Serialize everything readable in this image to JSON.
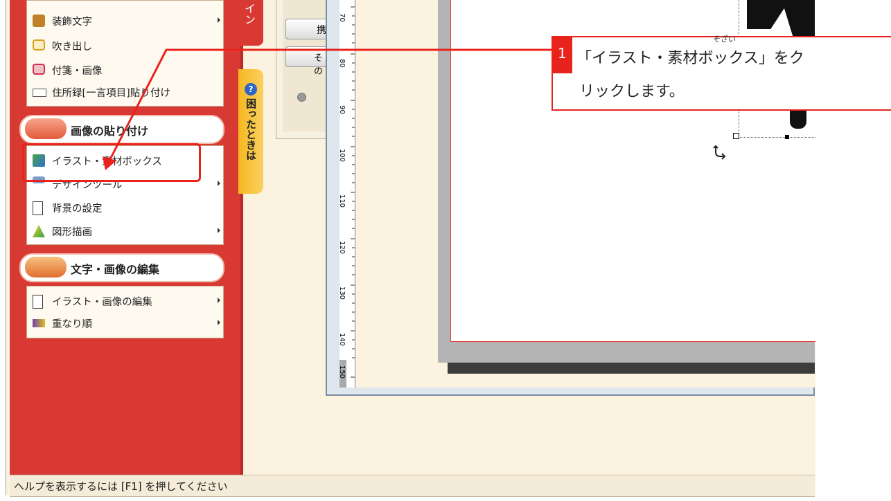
{
  "sidebar": {
    "tab_design": "イン",
    "help_tab": "困ったときは",
    "menu1": [
      {
        "label": "装飾文字",
        "icon": "decorative-text-icon",
        "has_submenu": true
      },
      {
        "label": "吹き出し",
        "icon": "speech-bubble-icon",
        "has_submenu": false
      },
      {
        "label": "付箋・画像",
        "icon": "sticky-note-icon",
        "has_submenu": false
      },
      {
        "label": "住所録[一言項目]貼り付け",
        "icon": "address-book-icon",
        "has_submenu": false
      }
    ],
    "section_paste": "画像の貼り付け",
    "menu2": [
      {
        "label": "イラスト・素材ボックス",
        "icon": "cube-icon",
        "has_submenu": false
      },
      {
        "label": "デザインツール",
        "icon": "design-tool-icon",
        "has_submenu": true
      },
      {
        "label": "背景の設定",
        "icon": "page-icon",
        "has_submenu": false
      },
      {
        "label": "図形描画",
        "icon": "shapes-icon",
        "has_submenu": true
      }
    ],
    "section_edit": "文字・画像の編集",
    "menu3": [
      {
        "label": "イラスト・画像の編集",
        "icon": "edit-image-icon",
        "has_submenu": true
      },
      {
        "label": "重なり順",
        "icon": "layer-order-icon",
        "has_submenu": true
      }
    ]
  },
  "panel": {
    "button1": "携",
    "button2": "その"
  },
  "ruler": {
    "ticks": [
      "70",
      "80",
      "90",
      "100",
      "110",
      "120",
      "130",
      "140",
      "150"
    ]
  },
  "callout": {
    "step": "1",
    "ruby": "そざい",
    "text_line1": "「イラスト・素材ボックス」をク",
    "text_line2": "リックします。"
  },
  "status_bar": {
    "text": "ヘルプを表示するには [F1] を押してください"
  },
  "colors": {
    "sidebar": "#d83a33",
    "highlight": "#e8231c",
    "canvas_bg": "#fbf3e0"
  }
}
